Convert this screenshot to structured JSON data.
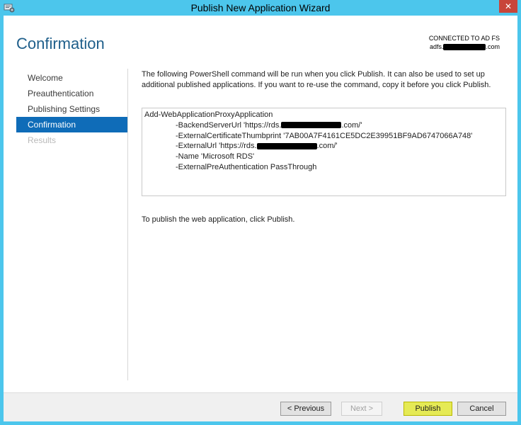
{
  "window": {
    "title": "Publish New Application Wizard",
    "close_label": "✕"
  },
  "header": {
    "page_title": "Confirmation",
    "connected_line1": "CONNECTED TO AD FS",
    "connected_prefix": "adfs.",
    "connected_suffix": ".com"
  },
  "nav": {
    "items": [
      {
        "label": "Welcome",
        "state": "normal"
      },
      {
        "label": "Preauthentication",
        "state": "normal"
      },
      {
        "label": "Publishing Settings",
        "state": "normal"
      },
      {
        "label": "Confirmation",
        "state": "active"
      },
      {
        "label": "Results",
        "state": "disabled"
      }
    ]
  },
  "main": {
    "description": "The following PowerShell command will be run when you click Publish. It can also be used to set up additional published applications. If you want to re-use the command, copy it before you click Publish.",
    "command": {
      "cmdlet": "Add-WebApplicationProxyApplication",
      "backend_prefix": "-BackendServerUrl 'https://rds.",
      "backend_suffix": ".com/'",
      "thumbprint": "-ExternalCertificateThumbprint '7AB00A7F4161CE5DC2E39951BF9AD6747066A748'",
      "external_prefix": "-ExternalUrl 'https://rds.",
      "external_suffix": ".com/'",
      "name": "-Name 'Microsoft RDS'",
      "preauth": "-ExternalPreAuthentication PassThrough"
    },
    "publish_hint": "To publish the web application, click Publish."
  },
  "footer": {
    "previous_label": "< Previous",
    "next_label": "Next >",
    "publish_label": "Publish",
    "cancel_label": "Cancel"
  },
  "colors": {
    "title_bar": "#4cc6ec",
    "accent": "#0f6cb8",
    "page_title": "#1f5f8b",
    "publish_highlight": "#e5ea55"
  }
}
